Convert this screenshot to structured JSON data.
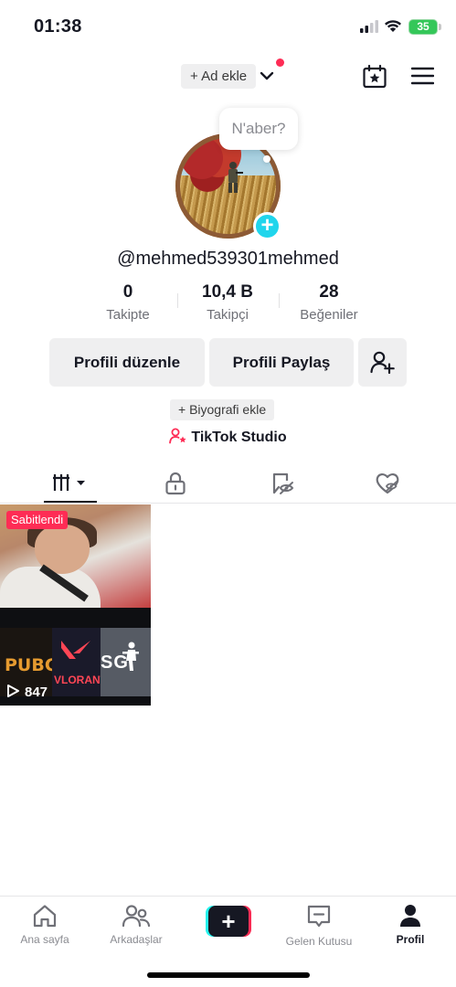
{
  "status_bar": {
    "time": "01:38",
    "battery": "35",
    "battery_color": "#34c759",
    "icons": [
      "cellular-signal-icon",
      "wifi-icon",
      "battery-icon"
    ]
  },
  "header": {
    "add_account_label": "+ Ad ekle",
    "notification_dot_color": "#fe2c55",
    "icons": [
      "chevron-down-icon",
      "calendar-star-icon",
      "hamburger-menu-icon"
    ]
  },
  "profile": {
    "note_bubble": "N'aber?",
    "username": "@mehmed539301mehmed",
    "add_avatar_icon": "plus-icon",
    "stats": [
      {
        "value": "0",
        "label": "Takipte"
      },
      {
        "value": "10,4 B",
        "label": "Takipçi"
      },
      {
        "value": "28",
        "label": "Beğeniler"
      }
    ],
    "edit_button": "Profili düzenle",
    "share_button": "Profili Paylaş",
    "add_friend_icon": "add-user-icon",
    "bio_button": "+ Biyografi ekle",
    "studio_label": "TikTok Studio"
  },
  "tabs": {
    "items": [
      "videos-grid-icon",
      "lock-icon",
      "repost-eye-icon",
      "liked-heart-icon"
    ],
    "active_index": 0
  },
  "videos": [
    {
      "badge": "Sabitlendi",
      "views": "847",
      "logos": [
        "PUBG",
        "VLORANT",
        "SG"
      ]
    }
  ],
  "bottom_nav": {
    "items": [
      {
        "label": "Ana sayfa",
        "icon": "home-icon"
      },
      {
        "label": "Arkadaşlar",
        "icon": "friends-icon"
      },
      {
        "label": "",
        "icon": "create-plus-icon"
      },
      {
        "label": "Gelen Kutusu",
        "icon": "inbox-icon"
      },
      {
        "label": "Profil",
        "icon": "profile-icon"
      }
    ],
    "active": "Profil"
  }
}
